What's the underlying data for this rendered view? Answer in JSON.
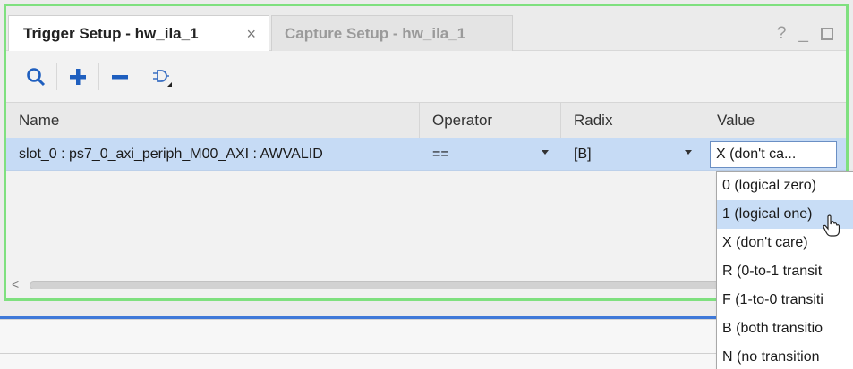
{
  "tabs": {
    "active": {
      "label": "Trigger Setup - hw_ila_1",
      "close": "×"
    },
    "inactive": {
      "label": "Capture Setup - hw_ila_1"
    }
  },
  "window_controls": {
    "help": "?",
    "minimize": "_"
  },
  "toolbar": {
    "buttons": [
      "search-icon",
      "plus-icon",
      "minus-icon",
      "trigger-icon"
    ]
  },
  "table": {
    "headers": {
      "name": "Name",
      "operator": "Operator",
      "radix": "Radix",
      "value": "Value"
    },
    "rows": [
      {
        "name": "slot_0 : ps7_0_axi_periph_M00_AXI : AWVALID",
        "operator": "==",
        "radix": "[B]",
        "value": "X (don't ca..."
      }
    ]
  },
  "scroll": {
    "left_arrow": "<"
  },
  "dropdown": {
    "options": [
      "0 (logical zero)",
      "1 (logical one)",
      "X (don't care)",
      "R (0-to-1 transit",
      "F (1-to-0 transiti",
      "B (both transitio",
      "N (no transition"
    ],
    "hovered_index": 1
  },
  "colors": {
    "focus_border": "#7fe07f",
    "selection": "#c6dbf5",
    "accent_blue": "#3e78d8"
  }
}
